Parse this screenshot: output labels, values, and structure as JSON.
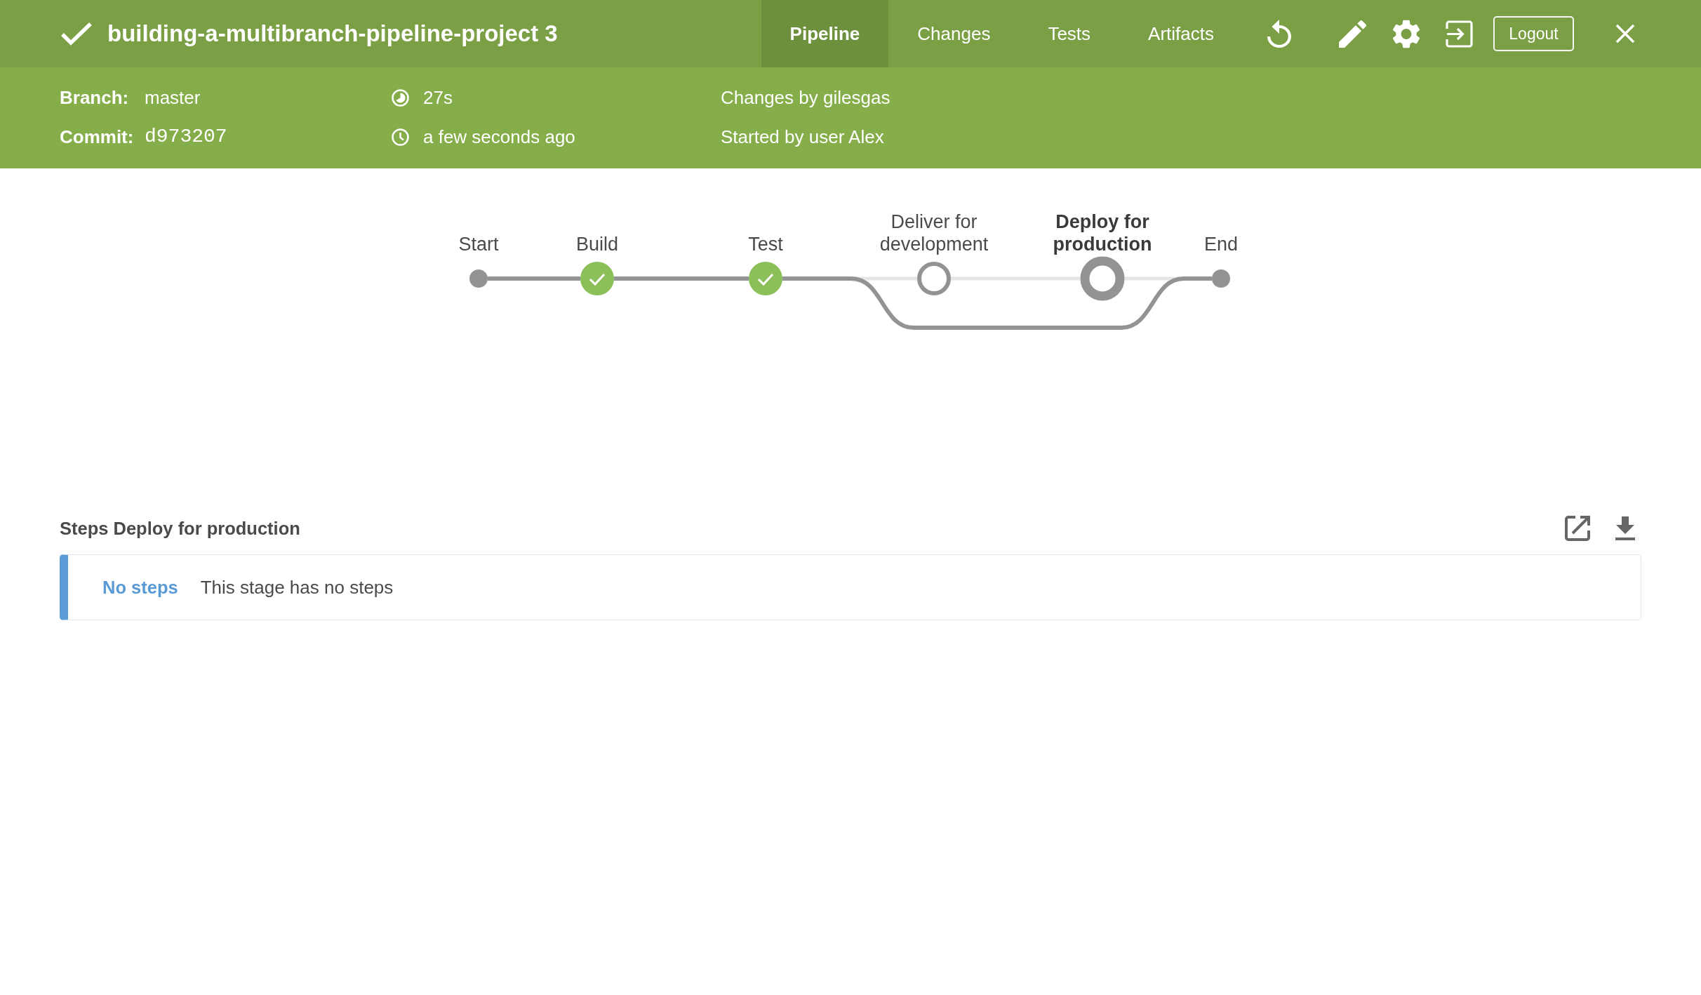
{
  "header": {
    "passed": true,
    "title": "building-a-multibranch-pipeline-project 3",
    "tabs": [
      {
        "label": "Pipeline",
        "selected": true
      },
      {
        "label": "Changes",
        "selected": false
      },
      {
        "label": "Tests",
        "selected": false
      },
      {
        "label": "Artifacts",
        "selected": false
      }
    ],
    "logout_button": "Logout"
  },
  "run_info": {
    "branch_label": "Branch:",
    "branch": "master",
    "commit_label": "Commit:",
    "commit": "d973207",
    "duration": "27s",
    "started": "a few seconds ago",
    "changes": "Changes by gilesgas",
    "started_by": "Started by user Alex"
  },
  "pipeline": {
    "nodes": [
      {
        "kind": "terminal",
        "label": "Start"
      },
      {
        "kind": "passed",
        "label": "Build",
        "selected": false
      },
      {
        "kind": "passed",
        "label": "Test",
        "selected": false
      },
      {
        "kind": "skipped",
        "label": "Deliver for development",
        "selected": false
      },
      {
        "kind": "skipped",
        "label": "Deploy for production",
        "selected": true
      },
      {
        "kind": "terminal",
        "label": "End"
      }
    ]
  },
  "steps": {
    "title": "Steps Deploy for production",
    "empty_label": "No steps",
    "empty_message": "This stage has no steps"
  }
}
